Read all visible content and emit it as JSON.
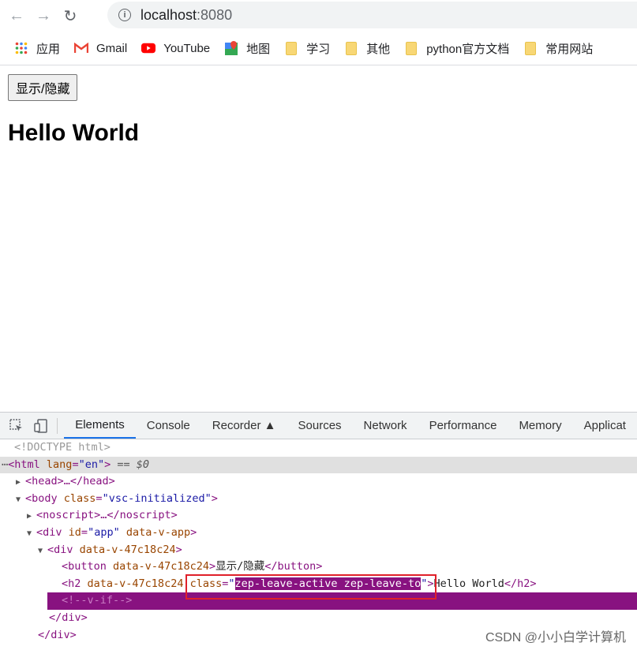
{
  "browser": {
    "url_host": "localhost",
    "url_port": ":8080",
    "bookmarks": [
      "应用",
      "Gmail",
      "YouTube",
      "地图",
      "学习",
      "其他",
      "python官方文档",
      "常用网站"
    ]
  },
  "page": {
    "button_label": "显示/隐藏",
    "heading": "Hello World"
  },
  "devtools": {
    "tabs": [
      "Elements",
      "Console",
      "Recorder",
      "Sources",
      "Network",
      "Performance",
      "Memory",
      "Applicat"
    ],
    "dom": {
      "doctype": "<!DOCTYPE html>",
      "html_open_a": "<html",
      "html_lang_attr": "lang",
      "html_lang_val": "\"en\"",
      "html_open_b": ">",
      "dollar0": " == $0",
      "head_line": "<head>…</head>",
      "body_open": "<body",
      "body_class_attr": "class",
      "body_class_val": "\"vsc-initialized\"",
      "noscript": "<noscript>…</noscript>",
      "div_app_open": "<div",
      "div_app_attrs": "id",
      "div_app_id": "\"app\"",
      "div_app_attr2": "data-v-app",
      "div_scoped_open": "<div",
      "div_scoped_attr": "data-v-47c18c24",
      "button_open": "<button",
      "button_attr": "data-v-47c18c24",
      "button_text": "显示/隐藏",
      "button_close": "</button>",
      "h2_open": "<h2",
      "h2_attr": "data-v-47c18c24",
      "h2_class_attr": "class",
      "h2_class_val": "zep-leave-active zep-leave-to",
      "h2_text": "Hello World",
      "h2_close": "</h2>",
      "comment": "<!--v-if-->",
      "div_close": "</div>"
    }
  },
  "watermark": "CSDN @小小白学计算机"
}
